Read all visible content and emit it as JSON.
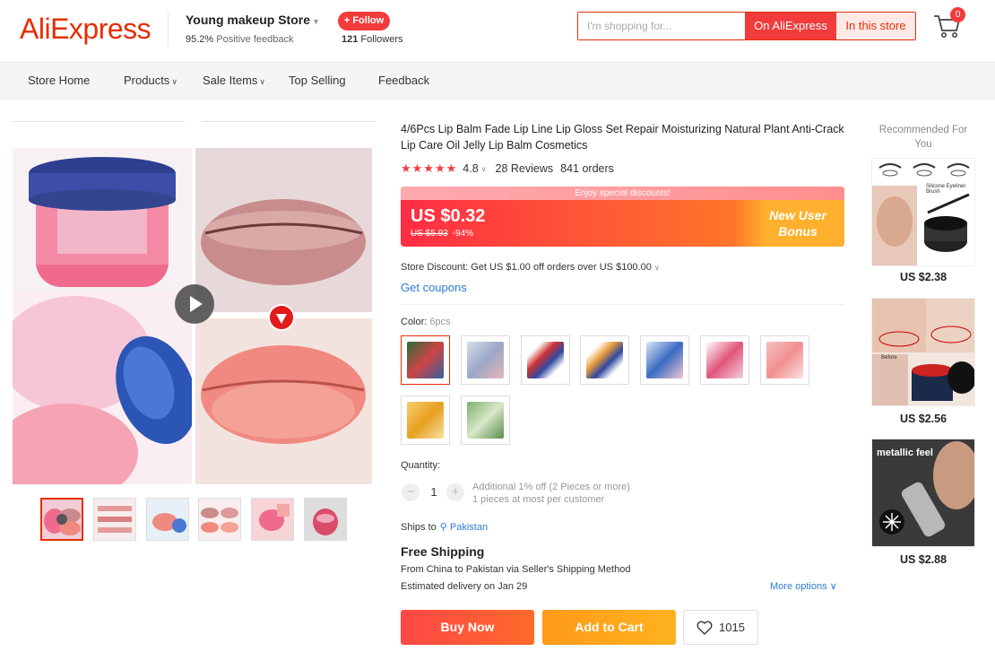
{
  "header": {
    "logo": "AliExpress",
    "store_name": "Young makeup Store",
    "feedback_percent": "95.2%",
    "feedback_label": "Positive feedback",
    "follow_label": "+ Follow",
    "followers_count": "121",
    "followers_label": "Followers",
    "search_placeholder": "I'm shopping for...",
    "search_on_ali": "On AliExpress",
    "search_in_store": "In this store",
    "cart_count": "0"
  },
  "nav": {
    "items": [
      "Store Home",
      "Products",
      "Sale Items",
      "Top Selling",
      "Feedback"
    ]
  },
  "product": {
    "title": "4/6Pcs Lip Balm Fade Lip Line Lip Gloss Set Repair Moisturizing Natural Plant Anti-Crack Lip Care Oil Jelly Lip Balm Cosmetics",
    "rating": "4.8",
    "reviews": "28 Reviews",
    "orders": "841 orders",
    "discount_banner": "Enjoy special discounts!",
    "price": "US $0.32",
    "old_price": "US $5.93",
    "discount_pct": "-94%",
    "new_user_bonus_1": "New User",
    "new_user_bonus_2": "Bonus",
    "store_discount": "Store Discount: Get US $1.00 off orders over US $100.00",
    "get_coupons": "Get coupons",
    "color_label": "Color:",
    "color_value": "6pcs",
    "quantity_label": "Quantity:",
    "quantity": "1",
    "qty_note_1": "Additional 1% off (2 Pieces or more)",
    "qty_note_2": "1 pieces at most per customer",
    "ships_to_label": "Ships to",
    "ships_to": "Pakistan",
    "free_shipping": "Free Shipping",
    "ship_route": "From China to Pakistan via Seller's Shipping Method",
    "ship_estimate": "Estimated delivery on Jan 29",
    "more_options": "More options",
    "buy_now": "Buy Now",
    "add_to_cart": "Add to Cart",
    "wishlist_count": "1015"
  },
  "recommended": {
    "title": "Recommended For You",
    "items": [
      {
        "price": "US $2.38",
        "label": "Silicone Eyeliner Brush"
      },
      {
        "price": "US $2.56",
        "label": "Before"
      },
      {
        "price": "US $2.88",
        "label": "metallic feel"
      }
    ]
  },
  "colors": {
    "accent": "#e62e04",
    "price_gradient_start": "#ff2c44",
    "price_gradient_end": "#ff8a1f",
    "link": "#2e7bd8"
  }
}
